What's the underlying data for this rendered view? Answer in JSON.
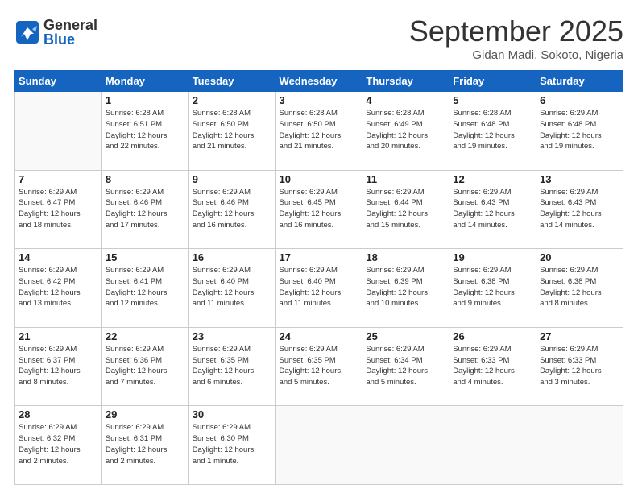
{
  "header": {
    "logo_general": "General",
    "logo_blue": "Blue",
    "title": "September 2025",
    "location": "Gidan Madi, Sokoto, Nigeria"
  },
  "days_of_week": [
    "Sunday",
    "Monday",
    "Tuesday",
    "Wednesday",
    "Thursday",
    "Friday",
    "Saturday"
  ],
  "weeks": [
    [
      {
        "day": "",
        "info": ""
      },
      {
        "day": "1",
        "info": "Sunrise: 6:28 AM\nSunset: 6:51 PM\nDaylight: 12 hours\nand 22 minutes."
      },
      {
        "day": "2",
        "info": "Sunrise: 6:28 AM\nSunset: 6:50 PM\nDaylight: 12 hours\nand 21 minutes."
      },
      {
        "day": "3",
        "info": "Sunrise: 6:28 AM\nSunset: 6:50 PM\nDaylight: 12 hours\nand 21 minutes."
      },
      {
        "day": "4",
        "info": "Sunrise: 6:28 AM\nSunset: 6:49 PM\nDaylight: 12 hours\nand 20 minutes."
      },
      {
        "day": "5",
        "info": "Sunrise: 6:28 AM\nSunset: 6:48 PM\nDaylight: 12 hours\nand 19 minutes."
      },
      {
        "day": "6",
        "info": "Sunrise: 6:29 AM\nSunset: 6:48 PM\nDaylight: 12 hours\nand 19 minutes."
      }
    ],
    [
      {
        "day": "7",
        "info": "Sunrise: 6:29 AM\nSunset: 6:47 PM\nDaylight: 12 hours\nand 18 minutes."
      },
      {
        "day": "8",
        "info": "Sunrise: 6:29 AM\nSunset: 6:46 PM\nDaylight: 12 hours\nand 17 minutes."
      },
      {
        "day": "9",
        "info": "Sunrise: 6:29 AM\nSunset: 6:46 PM\nDaylight: 12 hours\nand 16 minutes."
      },
      {
        "day": "10",
        "info": "Sunrise: 6:29 AM\nSunset: 6:45 PM\nDaylight: 12 hours\nand 16 minutes."
      },
      {
        "day": "11",
        "info": "Sunrise: 6:29 AM\nSunset: 6:44 PM\nDaylight: 12 hours\nand 15 minutes."
      },
      {
        "day": "12",
        "info": "Sunrise: 6:29 AM\nSunset: 6:43 PM\nDaylight: 12 hours\nand 14 minutes."
      },
      {
        "day": "13",
        "info": "Sunrise: 6:29 AM\nSunset: 6:43 PM\nDaylight: 12 hours\nand 14 minutes."
      }
    ],
    [
      {
        "day": "14",
        "info": "Sunrise: 6:29 AM\nSunset: 6:42 PM\nDaylight: 12 hours\nand 13 minutes."
      },
      {
        "day": "15",
        "info": "Sunrise: 6:29 AM\nSunset: 6:41 PM\nDaylight: 12 hours\nand 12 minutes."
      },
      {
        "day": "16",
        "info": "Sunrise: 6:29 AM\nSunset: 6:40 PM\nDaylight: 12 hours\nand 11 minutes."
      },
      {
        "day": "17",
        "info": "Sunrise: 6:29 AM\nSunset: 6:40 PM\nDaylight: 12 hours\nand 11 minutes."
      },
      {
        "day": "18",
        "info": "Sunrise: 6:29 AM\nSunset: 6:39 PM\nDaylight: 12 hours\nand 10 minutes."
      },
      {
        "day": "19",
        "info": "Sunrise: 6:29 AM\nSunset: 6:38 PM\nDaylight: 12 hours\nand 9 minutes."
      },
      {
        "day": "20",
        "info": "Sunrise: 6:29 AM\nSunset: 6:38 PM\nDaylight: 12 hours\nand 8 minutes."
      }
    ],
    [
      {
        "day": "21",
        "info": "Sunrise: 6:29 AM\nSunset: 6:37 PM\nDaylight: 12 hours\nand 8 minutes."
      },
      {
        "day": "22",
        "info": "Sunrise: 6:29 AM\nSunset: 6:36 PM\nDaylight: 12 hours\nand 7 minutes."
      },
      {
        "day": "23",
        "info": "Sunrise: 6:29 AM\nSunset: 6:35 PM\nDaylight: 12 hours\nand 6 minutes."
      },
      {
        "day": "24",
        "info": "Sunrise: 6:29 AM\nSunset: 6:35 PM\nDaylight: 12 hours\nand 5 minutes."
      },
      {
        "day": "25",
        "info": "Sunrise: 6:29 AM\nSunset: 6:34 PM\nDaylight: 12 hours\nand 5 minutes."
      },
      {
        "day": "26",
        "info": "Sunrise: 6:29 AM\nSunset: 6:33 PM\nDaylight: 12 hours\nand 4 minutes."
      },
      {
        "day": "27",
        "info": "Sunrise: 6:29 AM\nSunset: 6:33 PM\nDaylight: 12 hours\nand 3 minutes."
      }
    ],
    [
      {
        "day": "28",
        "info": "Sunrise: 6:29 AM\nSunset: 6:32 PM\nDaylight: 12 hours\nand 2 minutes."
      },
      {
        "day": "29",
        "info": "Sunrise: 6:29 AM\nSunset: 6:31 PM\nDaylight: 12 hours\nand 2 minutes."
      },
      {
        "day": "30",
        "info": "Sunrise: 6:29 AM\nSunset: 6:30 PM\nDaylight: 12 hours\nand 1 minute."
      },
      {
        "day": "",
        "info": ""
      },
      {
        "day": "",
        "info": ""
      },
      {
        "day": "",
        "info": ""
      },
      {
        "day": "",
        "info": ""
      }
    ]
  ]
}
